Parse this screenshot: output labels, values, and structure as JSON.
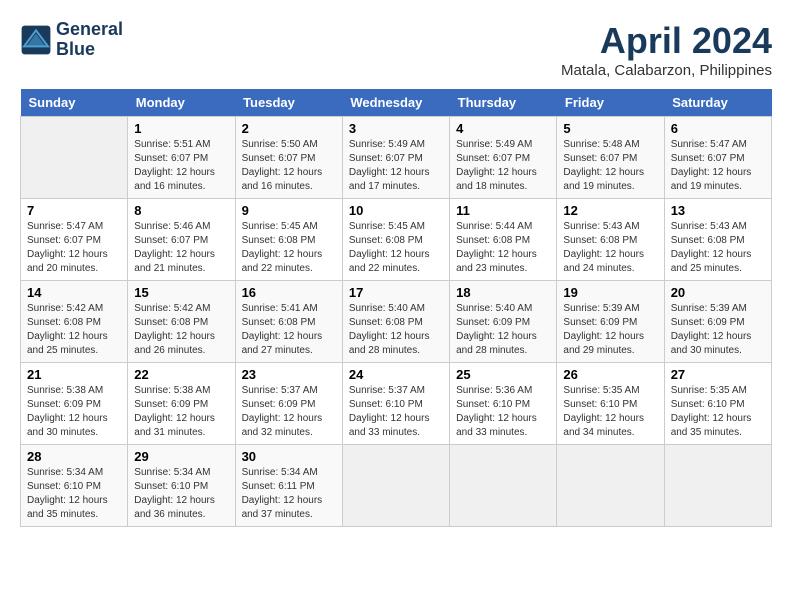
{
  "header": {
    "logo_line1": "General",
    "logo_line2": "Blue",
    "month": "April 2024",
    "location": "Matala, Calabarzon, Philippines"
  },
  "days_of_week": [
    "Sunday",
    "Monday",
    "Tuesday",
    "Wednesday",
    "Thursday",
    "Friday",
    "Saturday"
  ],
  "weeks": [
    [
      {
        "day": "",
        "info": ""
      },
      {
        "day": "1",
        "info": "Sunrise: 5:51 AM\nSunset: 6:07 PM\nDaylight: 12 hours\nand 16 minutes."
      },
      {
        "day": "2",
        "info": "Sunrise: 5:50 AM\nSunset: 6:07 PM\nDaylight: 12 hours\nand 16 minutes."
      },
      {
        "day": "3",
        "info": "Sunrise: 5:49 AM\nSunset: 6:07 PM\nDaylight: 12 hours\nand 17 minutes."
      },
      {
        "day": "4",
        "info": "Sunrise: 5:49 AM\nSunset: 6:07 PM\nDaylight: 12 hours\nand 18 minutes."
      },
      {
        "day": "5",
        "info": "Sunrise: 5:48 AM\nSunset: 6:07 PM\nDaylight: 12 hours\nand 19 minutes."
      },
      {
        "day": "6",
        "info": "Sunrise: 5:47 AM\nSunset: 6:07 PM\nDaylight: 12 hours\nand 19 minutes."
      }
    ],
    [
      {
        "day": "7",
        "info": "Sunrise: 5:47 AM\nSunset: 6:07 PM\nDaylight: 12 hours\nand 20 minutes."
      },
      {
        "day": "8",
        "info": "Sunrise: 5:46 AM\nSunset: 6:07 PM\nDaylight: 12 hours\nand 21 minutes."
      },
      {
        "day": "9",
        "info": "Sunrise: 5:45 AM\nSunset: 6:08 PM\nDaylight: 12 hours\nand 22 minutes."
      },
      {
        "day": "10",
        "info": "Sunrise: 5:45 AM\nSunset: 6:08 PM\nDaylight: 12 hours\nand 22 minutes."
      },
      {
        "day": "11",
        "info": "Sunrise: 5:44 AM\nSunset: 6:08 PM\nDaylight: 12 hours\nand 23 minutes."
      },
      {
        "day": "12",
        "info": "Sunrise: 5:43 AM\nSunset: 6:08 PM\nDaylight: 12 hours\nand 24 minutes."
      },
      {
        "day": "13",
        "info": "Sunrise: 5:43 AM\nSunset: 6:08 PM\nDaylight: 12 hours\nand 25 minutes."
      }
    ],
    [
      {
        "day": "14",
        "info": "Sunrise: 5:42 AM\nSunset: 6:08 PM\nDaylight: 12 hours\nand 25 minutes."
      },
      {
        "day": "15",
        "info": "Sunrise: 5:42 AM\nSunset: 6:08 PM\nDaylight: 12 hours\nand 26 minutes."
      },
      {
        "day": "16",
        "info": "Sunrise: 5:41 AM\nSunset: 6:08 PM\nDaylight: 12 hours\nand 27 minutes."
      },
      {
        "day": "17",
        "info": "Sunrise: 5:40 AM\nSunset: 6:08 PM\nDaylight: 12 hours\nand 28 minutes."
      },
      {
        "day": "18",
        "info": "Sunrise: 5:40 AM\nSunset: 6:09 PM\nDaylight: 12 hours\nand 28 minutes."
      },
      {
        "day": "19",
        "info": "Sunrise: 5:39 AM\nSunset: 6:09 PM\nDaylight: 12 hours\nand 29 minutes."
      },
      {
        "day": "20",
        "info": "Sunrise: 5:39 AM\nSunset: 6:09 PM\nDaylight: 12 hours\nand 30 minutes."
      }
    ],
    [
      {
        "day": "21",
        "info": "Sunrise: 5:38 AM\nSunset: 6:09 PM\nDaylight: 12 hours\nand 30 minutes."
      },
      {
        "day": "22",
        "info": "Sunrise: 5:38 AM\nSunset: 6:09 PM\nDaylight: 12 hours\nand 31 minutes."
      },
      {
        "day": "23",
        "info": "Sunrise: 5:37 AM\nSunset: 6:09 PM\nDaylight: 12 hours\nand 32 minutes."
      },
      {
        "day": "24",
        "info": "Sunrise: 5:37 AM\nSunset: 6:10 PM\nDaylight: 12 hours\nand 33 minutes."
      },
      {
        "day": "25",
        "info": "Sunrise: 5:36 AM\nSunset: 6:10 PM\nDaylight: 12 hours\nand 33 minutes."
      },
      {
        "day": "26",
        "info": "Sunrise: 5:35 AM\nSunset: 6:10 PM\nDaylight: 12 hours\nand 34 minutes."
      },
      {
        "day": "27",
        "info": "Sunrise: 5:35 AM\nSunset: 6:10 PM\nDaylight: 12 hours\nand 35 minutes."
      }
    ],
    [
      {
        "day": "28",
        "info": "Sunrise: 5:34 AM\nSunset: 6:10 PM\nDaylight: 12 hours\nand 35 minutes."
      },
      {
        "day": "29",
        "info": "Sunrise: 5:34 AM\nSunset: 6:10 PM\nDaylight: 12 hours\nand 36 minutes."
      },
      {
        "day": "30",
        "info": "Sunrise: 5:34 AM\nSunset: 6:11 PM\nDaylight: 12 hours\nand 37 minutes."
      },
      {
        "day": "",
        "info": ""
      },
      {
        "day": "",
        "info": ""
      },
      {
        "day": "",
        "info": ""
      },
      {
        "day": "",
        "info": ""
      }
    ]
  ]
}
